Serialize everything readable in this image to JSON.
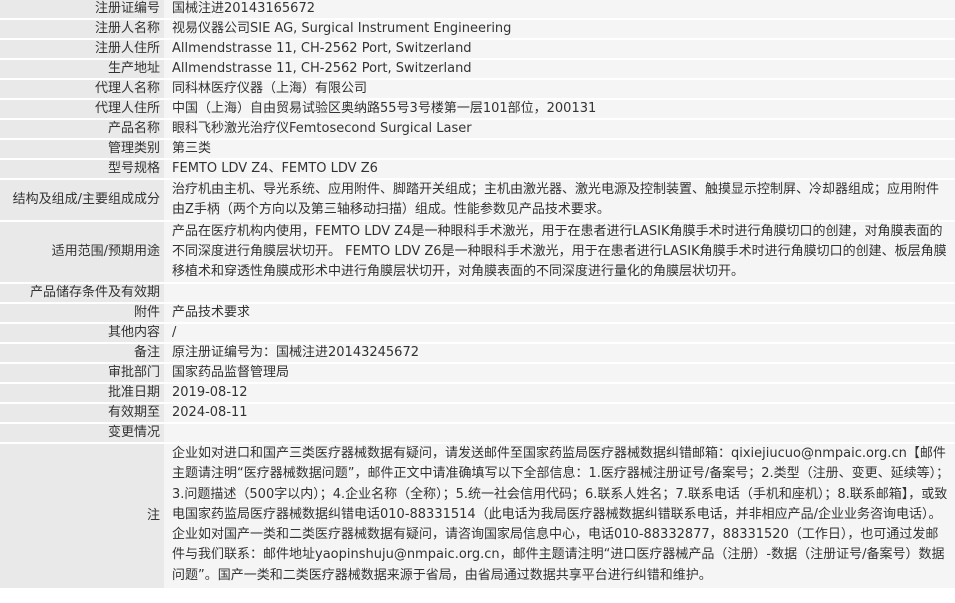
{
  "rows": [
    {
      "label": "注册证编号",
      "value": "国械注进20143165672"
    },
    {
      "label": "注册人名称",
      "value": "视易仪器公司SIE AG, Surgical Instrument Engineering"
    },
    {
      "label": "注册人住所",
      "value": "Allmendstrasse 11, CH-2562 Port, Switzerland"
    },
    {
      "label": "生产地址",
      "value": "Allmendstrasse 11, CH-2562 Port, Switzerland"
    },
    {
      "label": "代理人名称",
      "value": "同科林医疗仪器（上海）有限公司"
    },
    {
      "label": "代理人住所",
      "value": "中国（上海）自由贸易试验区奥纳路55号3号楼第一层101部位，200131"
    },
    {
      "label": "产品名称",
      "value": "眼科飞秒激光治疗仪Femtosecond Surgical Laser"
    },
    {
      "label": "管理类别",
      "value": "第三类"
    },
    {
      "label": "型号规格",
      "value": "FEMTO LDV Z4、FEMTO LDV Z6"
    },
    {
      "label": "结构及组成/主要组成成分",
      "value": "治疗机由主机、导光系统、应用附件、脚踏开关组成；主机由激光器、激光电源及控制装置、触摸显示控制屏、冷却器组成；应用附件由Z手柄（两个方向以及第三轴移动扫描）组成。性能参数见产品技术要求。"
    },
    {
      "label": "适用范围/预期用途",
      "value": "产品在医疗机构内使用，FEMTO LDV Z4是一种眼科手术激光，用于在患者进行LASIK角膜手术时进行角膜切口的创建，对角膜表面的不同深度进行角膜层状切开。 FEMTO LDV Z6是一种眼科手术激光，用于在患者进行LASIK角膜手术时进行角膜切口的创建、板层角膜移植术和穿透性角膜成形术中进行角膜层状切开，对角膜表面的不同深度进行量化的角膜层状切开。"
    },
    {
      "label": "产品储存条件及有效期",
      "value": ""
    },
    {
      "label": "附件",
      "value": "产品技术要求"
    },
    {
      "label": "其他内容",
      "value": "/"
    },
    {
      "label": "备注",
      "value": "原注册证编号为：国械注进20143245672"
    },
    {
      "label": "审批部门",
      "value": "国家药品监督管理局"
    },
    {
      "label": "批准日期",
      "value": "2019-08-12"
    },
    {
      "label": "有效期至",
      "value": "2024-08-11"
    },
    {
      "label": "变更情况",
      "value": ""
    }
  ],
  "note": {
    "label": "注",
    "value": "企业如对进口和国产三类医疗器械数据有疑问，请发送邮件至国家药监局医疗器械数据纠错邮箱：qixiejiucuo@nmpaic.org.cn【邮件主题请注明“医疗器械数据问题”，邮件正文中请准确填写以下全部信息：1.医疗器械注册证号/备案号；2.类型（注册、变更、延续等）；3.问题描述（500字以内）；4.企业名称（全称）；5.统一社会信用代码；6.联系人姓名；7.联系电话（手机和座机）；8.联系邮箱】，或致电国家药监局医疗器械数据纠错电话010-88331514（此电话为我局医疗器械数据纠错联系电话，并非相应产品/企业业务咨询电话）。企业如对国产一类和二类医疗器械数据有疑问，请咨询国家局信息中心，电话010-88332877，88331520（工作日），也可通过发邮件与我们联系：邮件地址yaopinshuju@nmpaic.org.cn，邮件主题请注明“进口医疗器械产品（注册）-数据（注册证号/备案号）数据问题”。国产一类和二类医疗器械数据来源于省局，由省局通过数据共享平台进行纠错和维护。"
  }
}
